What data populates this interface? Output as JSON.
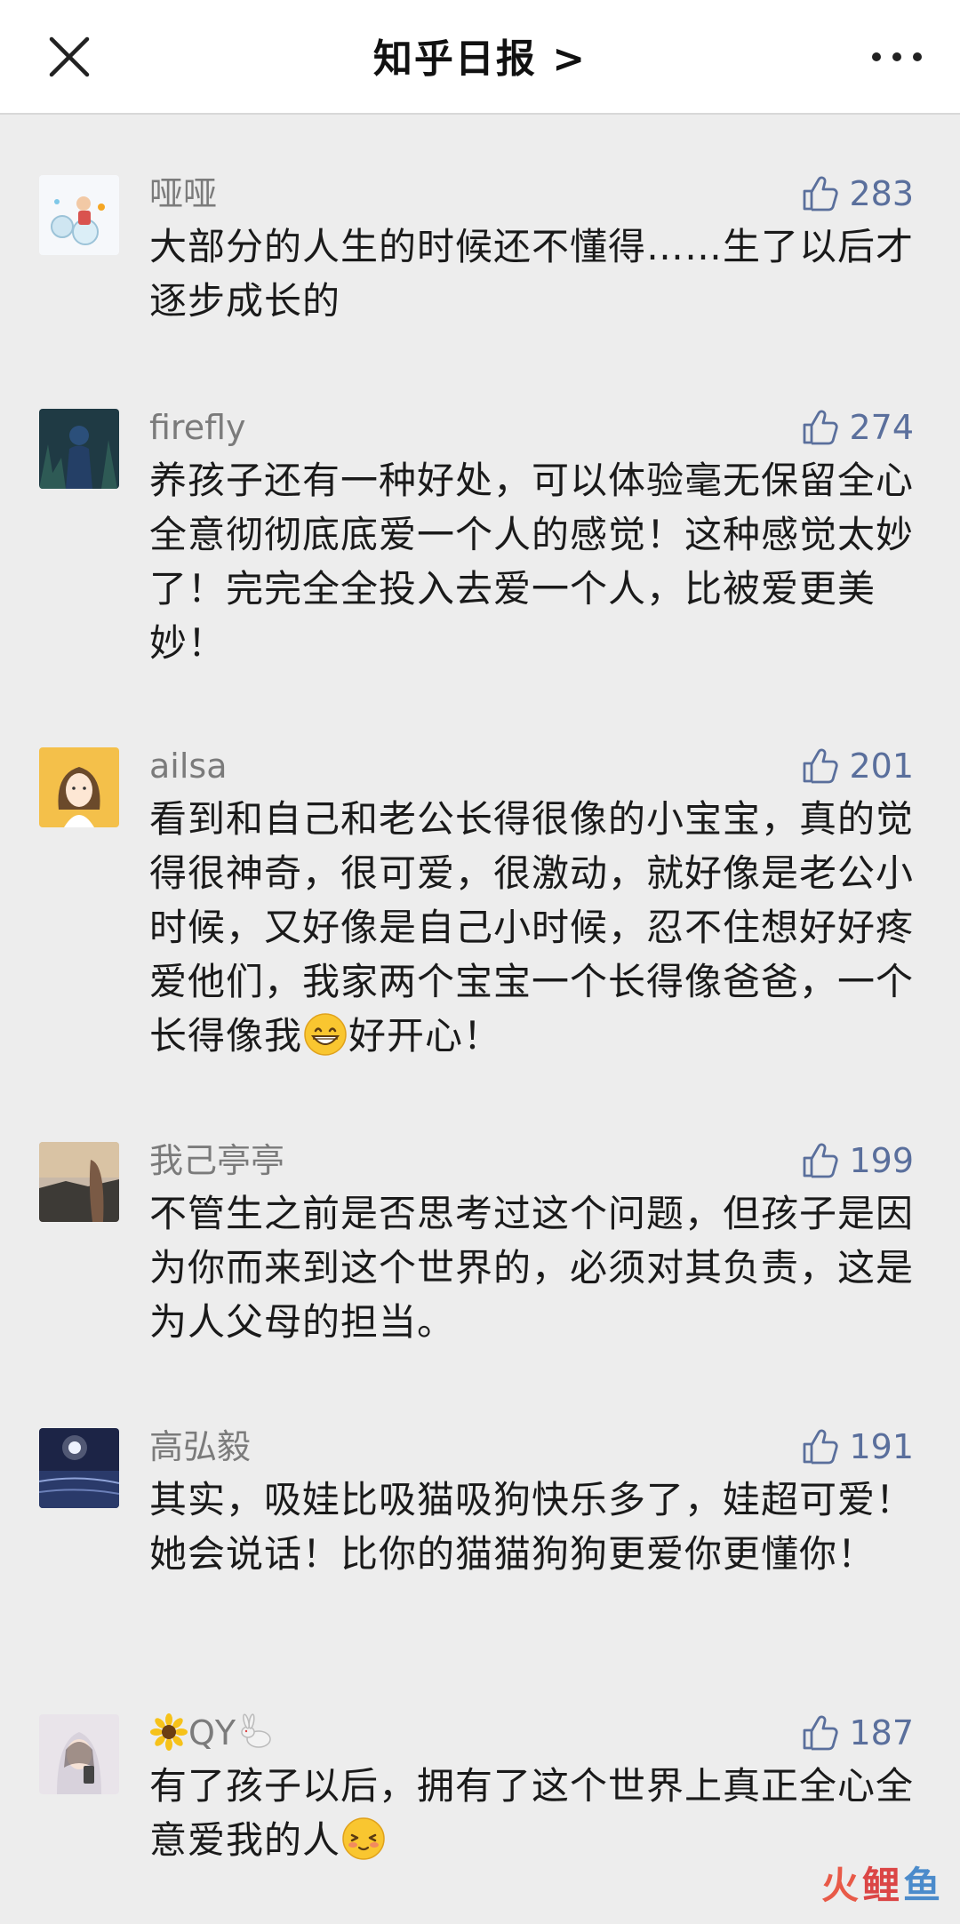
{
  "header": {
    "title": "知乎日报 >",
    "close_icon": "close-icon",
    "more_icon": "more-icon"
  },
  "comments": [
    {
      "name": "哑哑",
      "likes": "283",
      "text": "大部分的人生的时候还不懂得……生了以后才逐步成长的"
    },
    {
      "name": "firefly",
      "likes": "274",
      "text": "养孩子还有一种好处，可以体验毫无保留全心全意彻彻底底爱一个人的感觉！这种感觉太妙了！完完全全投入去爱一个人，比被爱更美妙！"
    },
    {
      "name": "ailsa",
      "likes": "201",
      "text_before_emoji": "看到和自己和老公长得很像的小宝宝，真的觉得很神奇，很可爱，很激动，就好像是老公小时候，又好像是自己小时候，忍不住想好好疼爱他们，我家两个宝宝一个长得像爸爸，一个长得像我",
      "text_after_emoji": "好开心！"
    },
    {
      "name": "我己亭亭",
      "likes": "199",
      "text": "不管生之前是否思考过这个问题，但孩子是因为你而来到这个世界的，必须对其负责，这是为人父母的担当。"
    },
    {
      "name": "高弘毅",
      "likes": "191",
      "text": "其实，吸娃比吸猫吸狗快乐多了，娃超可爱！她会说话！比你的猫猫狗狗更爱你更懂你！"
    },
    {
      "name": "QY",
      "likes": "187",
      "text_before_emoji": "有了孩子以后，拥有了这个世界上真正全心全意爱我的人"
    }
  ],
  "watermark": {
    "part1": "火",
    "part2": "鲤",
    "part3": "鱼"
  },
  "colors": {
    "like_blue": "#5a6f9c",
    "name_gray": "#7b7b7b",
    "background": "#ededed"
  }
}
